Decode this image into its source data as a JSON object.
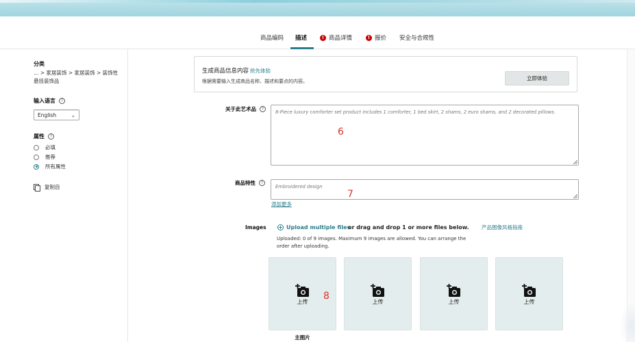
{
  "tabs": [
    {
      "label": "商品编码",
      "alert": false,
      "active": false
    },
    {
      "label": "描述",
      "alert": false,
      "active": true
    },
    {
      "label": "商品详情",
      "alert": true,
      "active": false
    },
    {
      "label": "报价",
      "alert": true,
      "active": false
    },
    {
      "label": "安全与合规性",
      "alert": false,
      "active": false
    }
  ],
  "sidebar": {
    "category_heading": "分类",
    "breadcrumb": "… > 家居装饰 > 家居装饰 > 装饰性悬挂装饰品",
    "language_heading": "输入语言",
    "language_value": "English",
    "attributes_heading": "属性",
    "radios": [
      {
        "label": "必填",
        "checked": false
      },
      {
        "label": "推荐",
        "checked": false
      },
      {
        "label": "所有属性",
        "checked": true
      }
    ],
    "copy_label": "复制自"
  },
  "generator": {
    "title": "生成商品信息内容",
    "badge": "抢先体验",
    "desc": "根据需要输入生成商品名称、描述和要点的内容。",
    "button": "立即体验"
  },
  "about": {
    "label": "关于此艺术品",
    "placeholder": "8-Piece luxury comforter set product includes 1 comforter, 1 bed skirt, 2 shams, 2 euro shams, and 2 decorated pillows."
  },
  "features": {
    "label": "商品特性",
    "placeholder": "Embroidered design",
    "add_more": "添加更多"
  },
  "images": {
    "label": "Images",
    "upload_link": "Upload multiple files",
    "drag_text": "or drag and drop 1 or more files below.",
    "guide_link": "产品图像风格指南",
    "note": "Uploaded: 0 of 9 images. Maximum 9 images are allowed. You can arrange the order after uploading.",
    "tile_label": "上传",
    "main_label": "主图片"
  },
  "annotations": {
    "a6": "6",
    "a7": "7",
    "a8": "8"
  },
  "colors": {
    "accent": "#2a7e8c",
    "alert": "#c40000",
    "annotation": "#d9332c"
  }
}
